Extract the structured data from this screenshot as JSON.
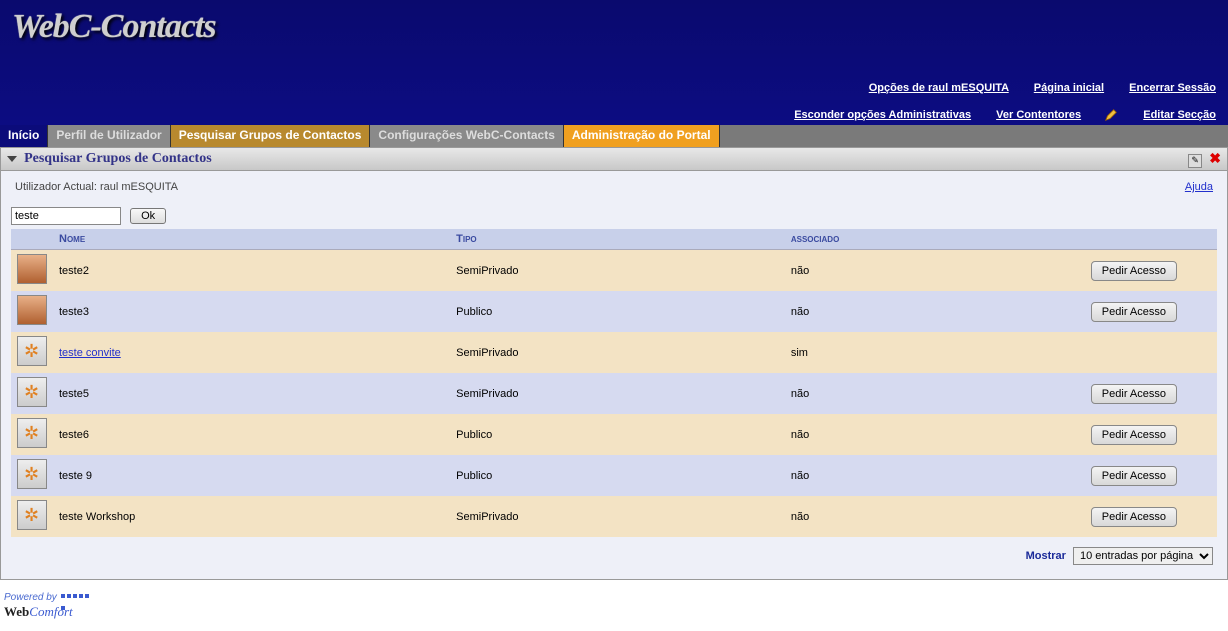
{
  "logo_text": "WebC-Contacts",
  "top_links_row1": {
    "opcoes": "Opções de raul mESQUITA",
    "inicial": "Página inicial",
    "encerrar": "Encerrar Sessão"
  },
  "top_links_row2": {
    "esconder": "Esconder opções Administrativas",
    "ver": "Ver Contentores",
    "editar": "Editar Secção"
  },
  "menu": {
    "inicio": "Início",
    "perfil": "Perfil de Utilizador",
    "pesquisar": "Pesquisar Grupos de Contactos",
    "config": "Configurações WebC-Contacts",
    "admin": "Administração do Portal"
  },
  "section_title": "Pesquisar Grupos de Contactos",
  "current_user_label": "Utilizador Actual: raul mESQUITA",
  "help_label": "Ajuda",
  "search_value": "teste",
  "ok_label": "Ok",
  "columns": {
    "nome": "Nome",
    "tipo": "Tipo",
    "associado": "associado"
  },
  "action_button": "Pedir Acesso",
  "rows": [
    {
      "nome": "teste2",
      "tipo": "SemiPrivado",
      "assoc": "não",
      "avatar": "face",
      "link": false,
      "action": true
    },
    {
      "nome": "teste3",
      "tipo": "Publico",
      "assoc": "não",
      "avatar": "face",
      "link": false,
      "action": true
    },
    {
      "nome": "teste convite",
      "tipo": "SemiPrivado",
      "assoc": "sim",
      "avatar": "group",
      "link": true,
      "action": false
    },
    {
      "nome": "teste5",
      "tipo": "SemiPrivado",
      "assoc": "não",
      "avatar": "group",
      "link": false,
      "action": true
    },
    {
      "nome": "teste6",
      "tipo": "Publico",
      "assoc": "não",
      "avatar": "group",
      "link": false,
      "action": true
    },
    {
      "nome": "teste 9",
      "tipo": "Publico",
      "assoc": "não",
      "avatar": "group",
      "link": false,
      "action": true
    },
    {
      "nome": "teste Workshop",
      "tipo": "SemiPrivado",
      "assoc": "não",
      "avatar": "group",
      "link": false,
      "action": true
    }
  ],
  "pager": {
    "label": "Mostrar",
    "selected": "10 entradas por página"
  },
  "footer": {
    "powered": "Powered by",
    "brand1": "Web",
    "brand2": "Comfort"
  }
}
